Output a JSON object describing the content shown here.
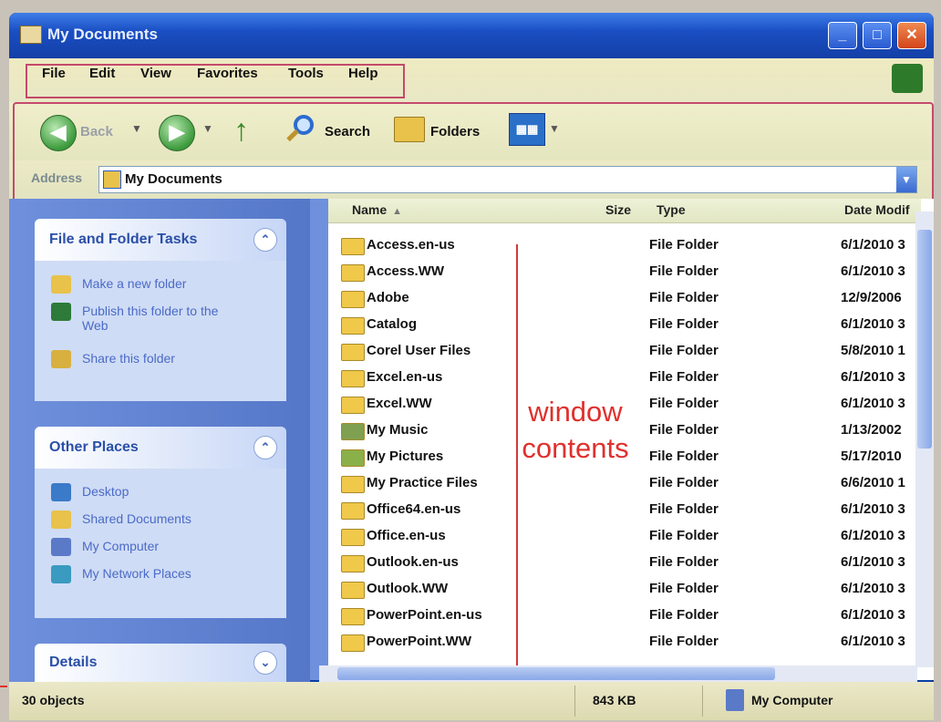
{
  "window": {
    "title": "My Documents"
  },
  "menu": [
    "File",
    "Edit",
    "View",
    "Favorites",
    "Tools",
    "Help"
  ],
  "toolbar": {
    "back": "Back",
    "search": "Search",
    "folders": "Folders",
    "views_glyph": "▦▦"
  },
  "address": {
    "label": "Address",
    "value": "My Documents"
  },
  "task_panes": {
    "file_folder": {
      "title": "File and Folder Tasks",
      "items": [
        "Make a new folder",
        "Publish this folder to the Web",
        "Share this folder"
      ]
    },
    "other_places": {
      "title": "Other Places",
      "items": [
        "Desktop",
        "Shared Documents",
        "My Computer",
        "My Network Places"
      ]
    },
    "details": {
      "title": "Details"
    }
  },
  "columns": {
    "name": "Name",
    "size": "Size",
    "type": "Type",
    "date": "Date Modif"
  },
  "files": [
    {
      "name": "Access.en-us",
      "type": "File Folder",
      "date": "6/1/2010 3"
    },
    {
      "name": "Access.WW",
      "type": "File Folder",
      "date": "6/1/2010 3"
    },
    {
      "name": "Adobe",
      "type": "File Folder",
      "date": "12/9/2006"
    },
    {
      "name": "Catalog",
      "type": "File Folder",
      "date": "6/1/2010 3"
    },
    {
      "name": "Corel User Files",
      "type": "File Folder",
      "date": "5/8/2010 1"
    },
    {
      "name": "Excel.en-us",
      "type": "File Folder",
      "date": "6/1/2010 3"
    },
    {
      "name": "Excel.WW",
      "type": "File Folder",
      "date": "6/1/2010 3"
    },
    {
      "name": "My Music",
      "type": "File Folder",
      "date": "1/13/2002"
    },
    {
      "name": "My Pictures",
      "type": "File Folder",
      "date": "5/17/2010"
    },
    {
      "name": "My Practice Files",
      "type": "File Folder",
      "date": "6/6/2010 1"
    },
    {
      "name": "Office64.en-us",
      "type": "File Folder",
      "date": "6/1/2010 3"
    },
    {
      "name": "Office.en-us",
      "type": "File Folder",
      "date": "6/1/2010 3"
    },
    {
      "name": "Outlook.en-us",
      "type": "File Folder",
      "date": "6/1/2010 3"
    },
    {
      "name": "Outlook.WW",
      "type": "File Folder",
      "date": "6/1/2010 3"
    },
    {
      "name": "PowerPoint.en-us",
      "type": "File Folder",
      "date": "6/1/2010 3"
    },
    {
      "name": "PowerPoint.WW",
      "type": "File Folder",
      "date": "6/1/2010 3"
    }
  ],
  "annotation": {
    "line1": "window",
    "line2": "contents"
  },
  "status": {
    "objects": "30 objects",
    "size": "843 KB",
    "location": "My Computer"
  },
  "colors": {
    "titlebar": "#1a4fc4",
    "task_pane": "#6f90dc",
    "annotation": "#e0302c",
    "highlight_box": "#c44a6c"
  }
}
